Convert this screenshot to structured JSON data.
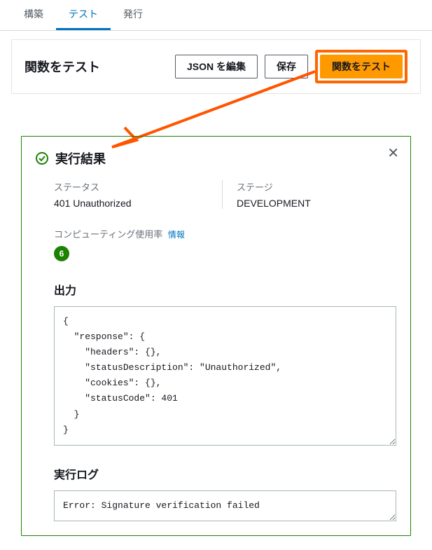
{
  "tabs": {
    "items": [
      {
        "label": "構築",
        "active": false
      },
      {
        "label": "テスト",
        "active": true
      },
      {
        "label": "発行",
        "active": false
      }
    ]
  },
  "toolbar": {
    "title": "関数をテスト",
    "edit_json_label": "JSON を編集",
    "save_label": "保存",
    "test_label": "関数をテスト"
  },
  "result": {
    "title": "実行結果",
    "status_label": "ステータス",
    "status_value": "401 Unauthorized",
    "stage_label": "ステージ",
    "stage_value": "DEVELOPMENT",
    "compute_label": "コンピューティング使用率",
    "info_link": "情報",
    "compute_value": "6",
    "output_title": "出力",
    "output_body": "{\n  \"response\": {\n    \"headers\": {},\n    \"statusDescription\": \"Unauthorized\",\n    \"cookies\": {},\n    \"statusCode\": 401\n  }\n}",
    "log_title": "実行ログ",
    "log_body": "Error: Signature verification failed"
  },
  "icons": {
    "close": "✕"
  }
}
